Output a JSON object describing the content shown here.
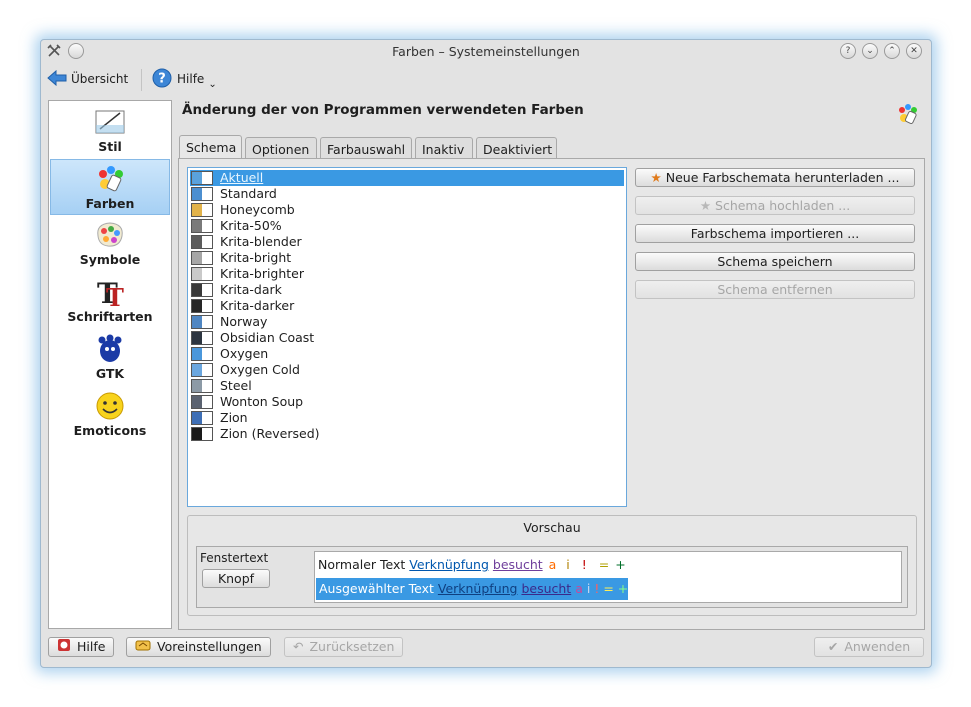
{
  "window": {
    "title": "Farben – Systemeinstellungen",
    "titlebar_buttons": [
      "?",
      "⌄",
      "⌃",
      "✕"
    ]
  },
  "toolbar": {
    "overview_label": "Übersicht",
    "help_label": "Hilfe"
  },
  "sidebar": {
    "items": [
      {
        "label": "Stil",
        "icon": "style-icon"
      },
      {
        "label": "Farben",
        "icon": "colors-icon",
        "selected": true
      },
      {
        "label": "Symbole",
        "icon": "icons-icon"
      },
      {
        "label": "Schriftarten",
        "icon": "fonts-icon"
      },
      {
        "label": "GTK",
        "icon": "gtk-icon"
      },
      {
        "label": "Emoticons",
        "icon": "emoticons-icon"
      }
    ]
  },
  "main": {
    "heading": "Änderung der von Programmen verwendeten Farben",
    "tabs": [
      {
        "label": "Schema",
        "selected": true
      },
      {
        "label": "Optionen"
      },
      {
        "label": "Farbauswahl"
      },
      {
        "label": "Inaktiv"
      },
      {
        "label": "Deaktiviert"
      }
    ],
    "schemes": [
      {
        "name": "Aktuell",
        "selected": true,
        "swatch": "#5aa2dc"
      },
      {
        "name": "Standard",
        "swatch": "#4c8fd0"
      },
      {
        "name": "Honeycomb",
        "swatch": "#e2b34a"
      },
      {
        "name": "Krita-50%",
        "swatch": "#7a7a7a"
      },
      {
        "name": "Krita-blender",
        "swatch": "#5c5c5c"
      },
      {
        "name": "Krita-bright",
        "swatch": "#a6a6a6"
      },
      {
        "name": "Krita-brighter",
        "swatch": "#c9c9c9"
      },
      {
        "name": "Krita-dark",
        "swatch": "#3a3a3a"
      },
      {
        "name": "Krita-darker",
        "swatch": "#262626"
      },
      {
        "name": "Norway",
        "swatch": "#4f86c2"
      },
      {
        "name": "Obsidian Coast",
        "swatch": "#2c3540"
      },
      {
        "name": "Oxygen",
        "swatch": "#4a97db"
      },
      {
        "name": "Oxygen Cold",
        "swatch": "#6aa6de"
      },
      {
        "name": "Steel",
        "swatch": "#8c9aa6"
      },
      {
        "name": "Wonton Soup",
        "swatch": "#5a6270"
      },
      {
        "name": "Zion",
        "swatch": "#3e6fb6"
      },
      {
        "name": "Zion (Reversed)",
        "swatch": "#1a1a1a"
      }
    ],
    "buttons": {
      "download": "Neue Farbschemata herunterladen ...",
      "upload": "Schema hochladen ...",
      "import": "Farbschema importieren ...",
      "save": "Schema speichern",
      "remove": "Schema entfernen"
    },
    "preview": {
      "title": "Vorschau",
      "window_text": "Fenstertext",
      "button_label": "Knopf",
      "normal_text": "Normaler Text",
      "link": "Verknüpfung",
      "visited": "besucht",
      "a": "a",
      "i": "i",
      "excl": "!",
      "eq": "=",
      "plus": "+",
      "selected_text": "Ausgewählter Text"
    }
  },
  "footer": {
    "help": "Hilfe",
    "defaults": "Voreinstellungen",
    "reset": "Zurücksetzen",
    "apply": "Anwenden"
  },
  "colors": {
    "selection": "#3a99e3",
    "link": "#0057ae",
    "visited": "#6f3f9b",
    "active": "#ff6c00",
    "negative": "#c00000",
    "neutral": "#b08000",
    "positive": "#006e28"
  }
}
